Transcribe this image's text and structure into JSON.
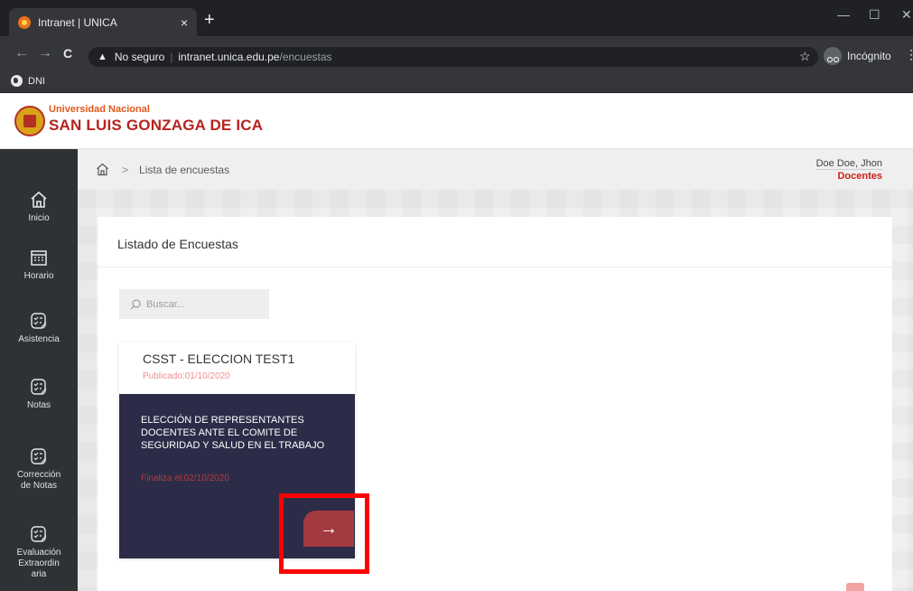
{
  "browser": {
    "tab_title": "Intranet | UNICA",
    "tab_close": "×",
    "new_tab": "+",
    "win_min": "—",
    "win_max": "☐",
    "win_close": "✕",
    "back": "←",
    "forward": "→",
    "reload": "C",
    "warning_icon": "▲",
    "security_text": "No seguro",
    "url_domain": "intranet.unica.edu.pe",
    "url_path": "/encuestas",
    "star": "☆",
    "incognito_label": "Incógnito",
    "menu": "⋮",
    "bookmark": "DNI"
  },
  "header": {
    "logo_small": "Universidad Nacional",
    "logo_big": "SAN LUIS GONZAGA DE ICA"
  },
  "sidebar": {
    "items": [
      {
        "label": "Inicio",
        "icon": "home-icon"
      },
      {
        "label": "Horario",
        "icon": "calendar-icon"
      },
      {
        "label": "Asistencia",
        "icon": "checklist-icon"
      },
      {
        "label": "Notas",
        "icon": "checklist-icon"
      },
      {
        "label": "Corrección de Notas",
        "icon": "checklist-icon"
      },
      {
        "label": "Evaluación Extraordin aria",
        "icon": "checklist-icon"
      }
    ]
  },
  "breadcrumb": {
    "separator": ">",
    "current": "Lista de encuestas"
  },
  "user": {
    "name": "Doe Doe, Jhon",
    "role": "Docentes"
  },
  "panel": {
    "title": "Listado de Encuestas",
    "search_placeholder": "Buscar..."
  },
  "survey_card": {
    "title": "CSST - ELECCION TEST1",
    "published": "Publicado:01/10/2020",
    "description": "ELECCIÓN DE REPRESENTANTES DOCENTES ANTE EL COMITE DE SEGURIDAD Y SALUD EN EL TRABAJO",
    "ends": "Finaliza el:02/10/2020",
    "go_arrow": "→"
  },
  "colors": {
    "accent": "#c8201a",
    "card_body": "#2c2c48",
    "go_button": "#a33a40",
    "highlight": "#ff0000"
  }
}
